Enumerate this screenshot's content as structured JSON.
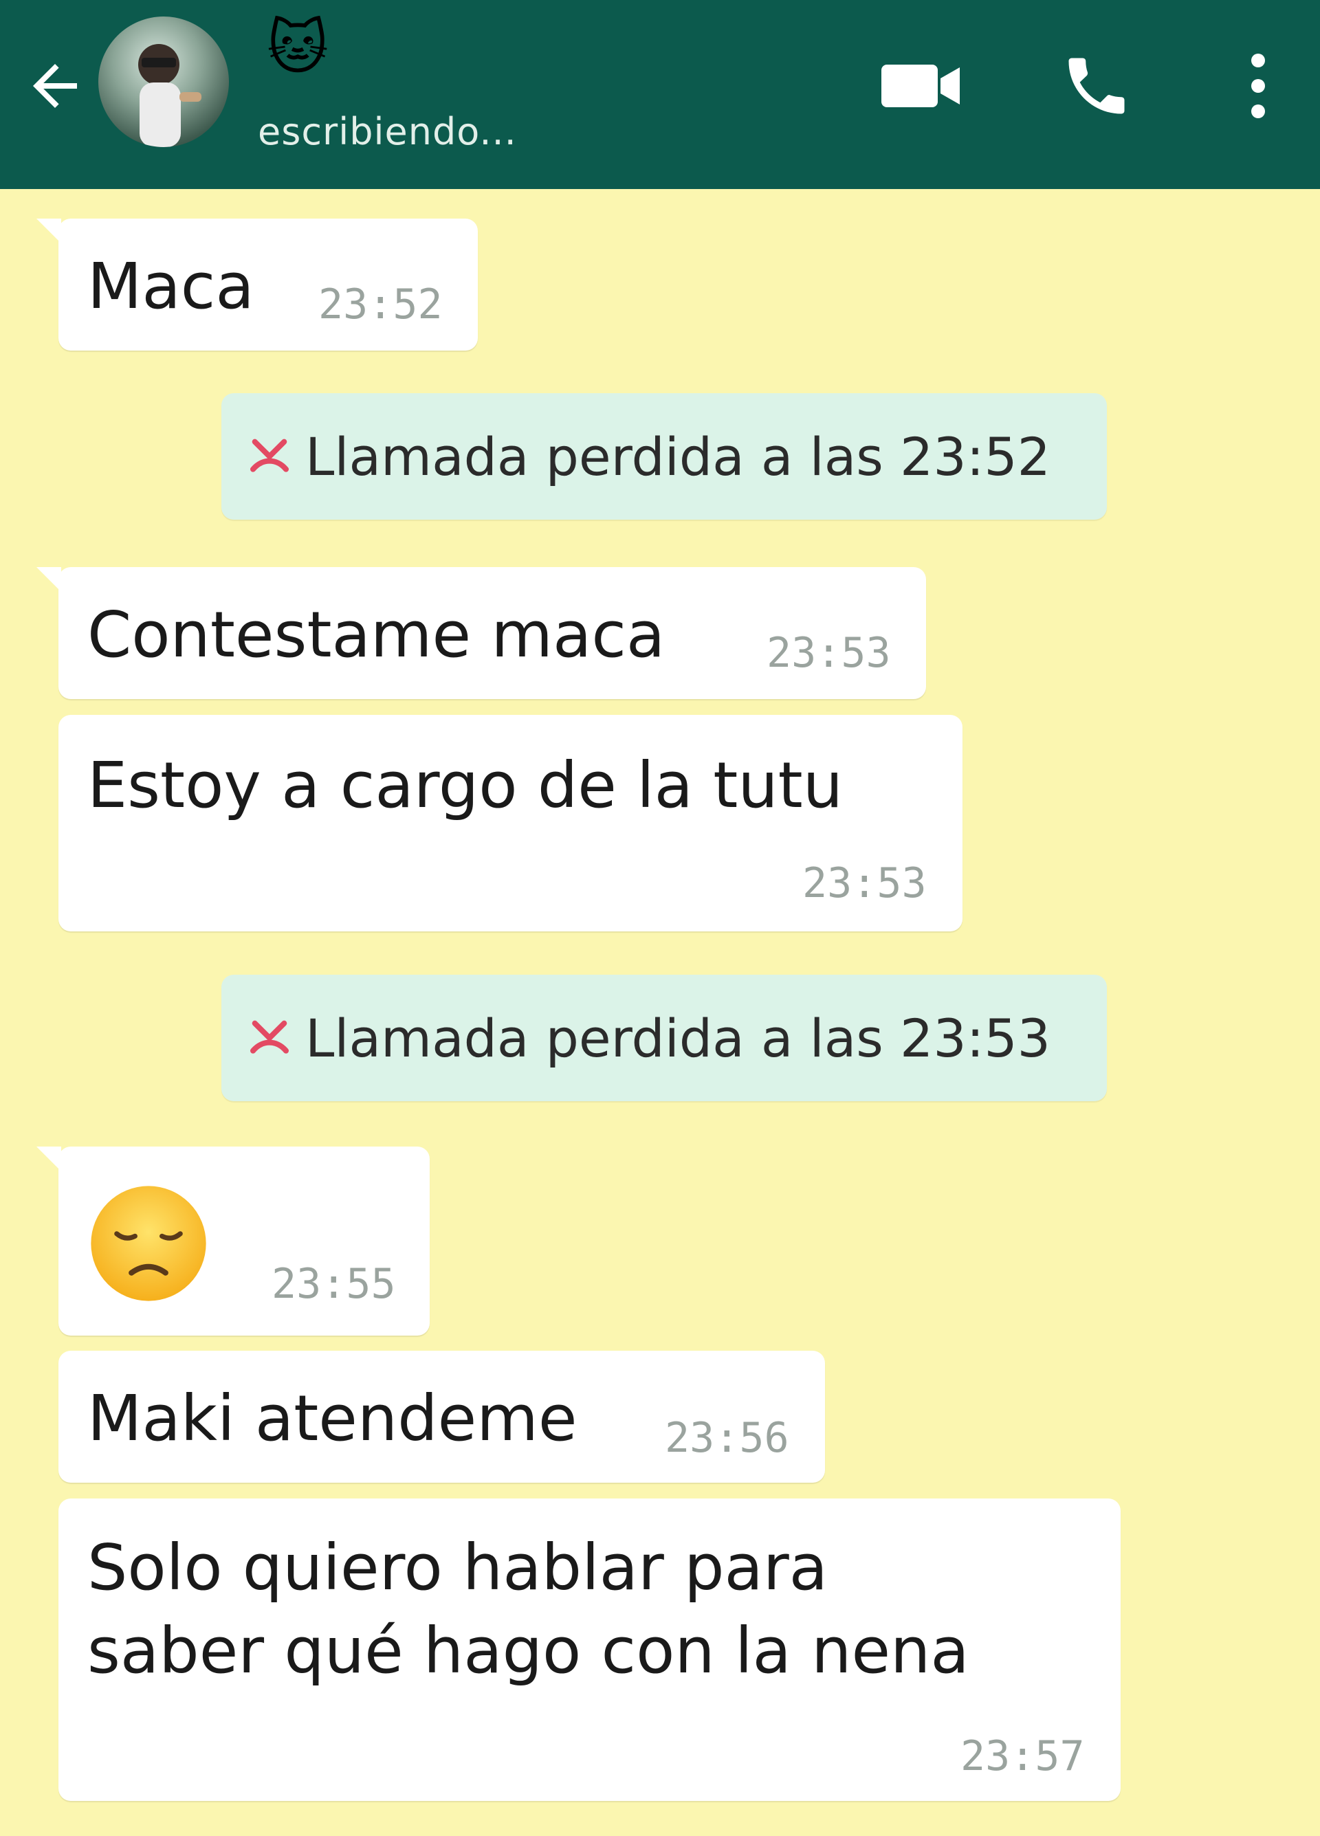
{
  "header": {
    "contact_emoji": "🐱",
    "status": "escribiendo...",
    "icons": {
      "back": "arrow-left-icon",
      "video": "video-camera-icon",
      "phone": "phone-icon",
      "menu": "more-vert-icon"
    },
    "color": "#0c5a4d"
  },
  "chat": {
    "background": "#fbf6b0",
    "messages": [
      {
        "type": "incoming",
        "text": "Maca",
        "time": "23:52"
      },
      {
        "type": "system",
        "icon": "missed-call-icon",
        "text": "Llamada perdida a las 23:52"
      },
      {
        "type": "incoming",
        "text": "Contestame maca",
        "time": "23:53"
      },
      {
        "type": "incoming",
        "text": "Estoy a cargo de la tutu",
        "time": "23:53"
      },
      {
        "type": "system",
        "icon": "missed-call-icon",
        "text": "Llamada perdida a las 23:53"
      },
      {
        "type": "incoming",
        "emoji": "😔",
        "time": "23:55"
      },
      {
        "type": "incoming",
        "text": "Maki atendeme",
        "time": "23:56"
      },
      {
        "type": "incoming",
        "text": "Solo quiero hablar para\nsaber qué hago con la nena",
        "time": "23:57"
      }
    ]
  }
}
